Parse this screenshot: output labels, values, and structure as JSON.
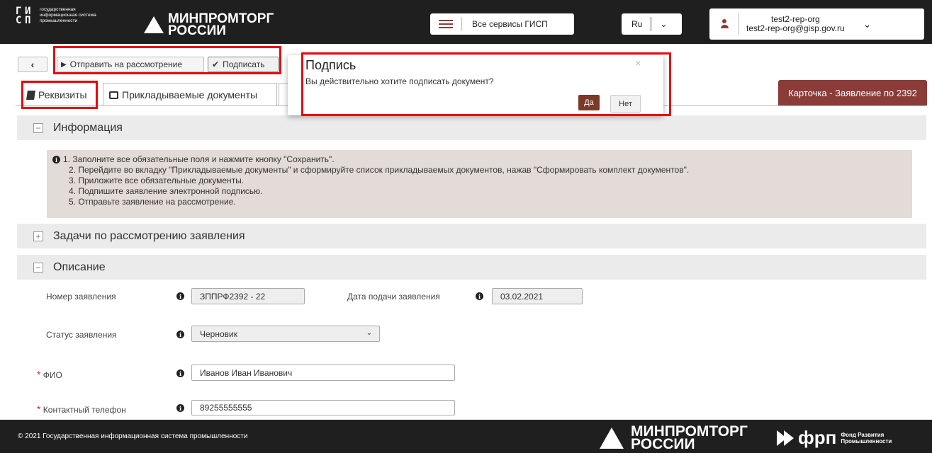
{
  "header": {
    "gisp_text": "государственная информационная система промышленности",
    "minprom_line1": "МИНПРОМТОРГ",
    "minprom_line2": "РОССИИ",
    "services_label": "Все сервисы ГИСП",
    "language": "Ru",
    "user_name": "test2-rep-org",
    "user_email": "test2-rep-org@gisp.gov.ru"
  },
  "toolbar": {
    "back_icon": "chevron-left-icon",
    "send_label": "Отправить на рассмотрение",
    "sign_label": "Подписать"
  },
  "tabs": [
    {
      "label": "Реквизиты",
      "icon": "book-icon"
    },
    {
      "label": "Прикладываемые документы",
      "icon": "folder-icon"
    }
  ],
  "card_tab": "Карточка - Заявление по 2392",
  "modal": {
    "title": "Подпись",
    "text": "Вы действительно хотите подписать документ?",
    "close": "×",
    "yes": "Да",
    "no": "Нет"
  },
  "sections": {
    "info": "Информация",
    "tasks": "Задачи по рассмотрению заявления",
    "description": "Описание"
  },
  "info_lines": [
    "1. Заполните все обязательные поля и нажмите кнопку \"Сохранить\".",
    "2. Перейдите во вкладку \"Прикладываемые документы\" и сформируйте список прикладываемых документов, нажав \"Сформировать комплект документов\".",
    "3. Приложите все обязательные документы.",
    "4. Подпишите заявление электронной подписью.",
    "5. Отправьте заявление на рассмотрение."
  ],
  "form": {
    "number_label": "Номер заявления",
    "number_value": "ЗППРФ2392 - 22",
    "date_label": "Дата подачи заявления",
    "date_value": "03.02.2021",
    "status_label": "Статус заявления",
    "status_value": "Черновик",
    "fio_label": "ФИО",
    "fio_value": "Иванов Иван Иванович",
    "phone_label": "Контактный телефон",
    "phone_value": "89255555555",
    "required_mark": "*"
  },
  "footer": {
    "copyright": "© 2021 Государственная информационная система промышленности",
    "minprom_line1": "МИНПРОМТОРГ",
    "minprom_line2": "РОССИИ",
    "frp_logo": "фрп",
    "frp_text_1": "Фонд Развития",
    "frp_text_2": "Промышленности"
  },
  "colors": {
    "header_bg": "#1f1f1f",
    "accent": "#8b3c39",
    "highlight": "#e8090d",
    "yes_button": "#7a3a27"
  }
}
